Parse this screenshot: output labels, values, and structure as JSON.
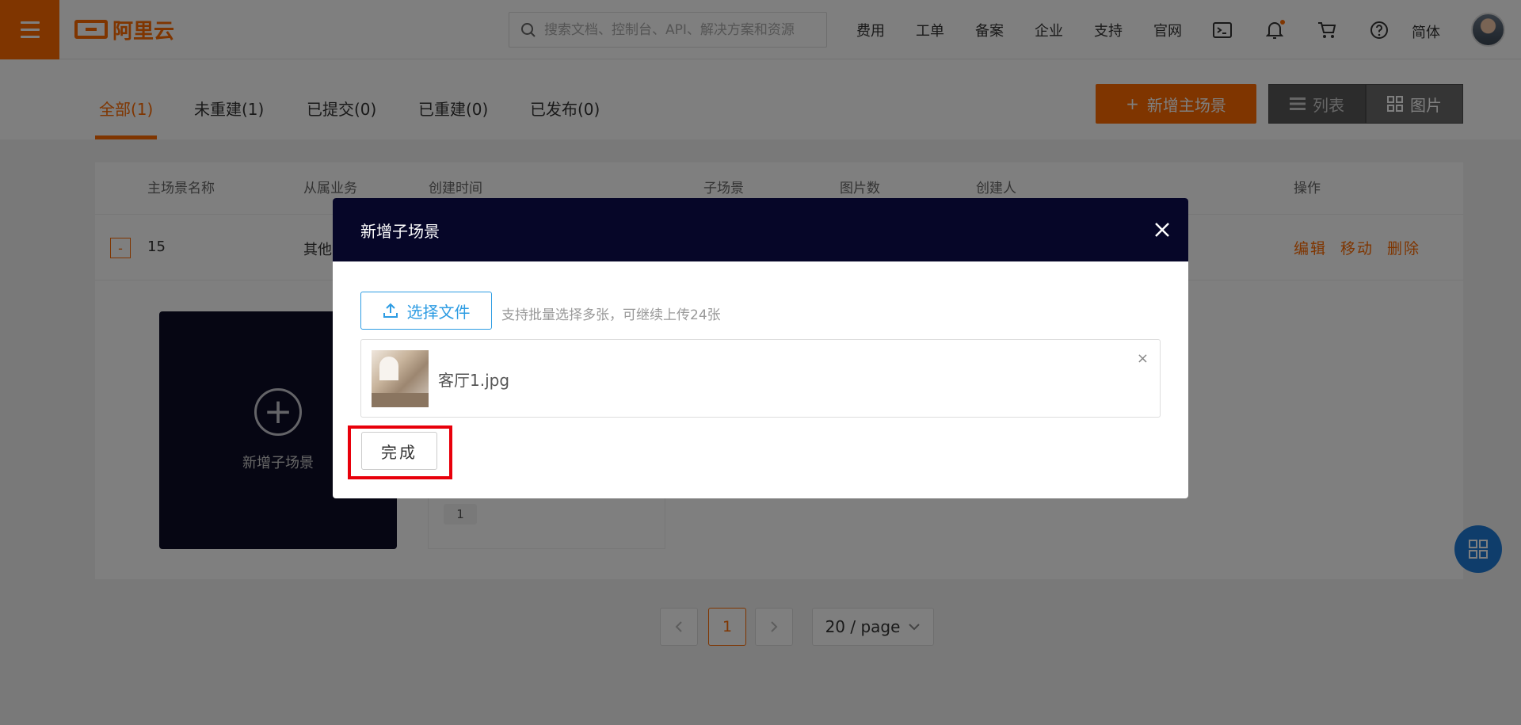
{
  "header": {
    "logo_text": "阿里云",
    "search_placeholder": "搜索文档、控制台、API、解决方案和资源",
    "nav": [
      "费用",
      "工单",
      "备案",
      "企业",
      "支持",
      "官网"
    ],
    "language": "简体",
    "icons": [
      "terminal-icon",
      "bell-icon",
      "cart-icon",
      "help-icon"
    ]
  },
  "tabs": [
    {
      "label": "全部(1)",
      "active": true
    },
    {
      "label": "未重建(1)"
    },
    {
      "label": "已提交(0)"
    },
    {
      "label": "已重建(0)"
    },
    {
      "label": "已发布(0)"
    }
  ],
  "toolbar": {
    "add_main_scene": "新增主场景",
    "view_list": "列表",
    "view_grid": "图片"
  },
  "table": {
    "columns": [
      "主场景名称",
      "从属业务",
      "创建时间",
      "子场景",
      "图片数",
      "创建人",
      "操作"
    ],
    "row": {
      "expand": "-",
      "name": "15",
      "business": "其他",
      "actions": [
        "编辑",
        "移动",
        "删除"
      ]
    },
    "add_sub_scene_label": "新增子场景",
    "scene_card_count": "1"
  },
  "pagination": {
    "current_page": "1",
    "page_size": "20 / page"
  },
  "modal": {
    "title": "新增子场景",
    "choose_file": "选择文件",
    "hint": "支持批量选择多张，可继续上传24张",
    "file_name": "客厅1.jpg",
    "remove": "×",
    "done": "完成"
  },
  "colors": {
    "accent": "#ff6a00",
    "modal_header": "#060628",
    "link_blue": "#2d9ce3",
    "highlight": "#e8000b"
  }
}
